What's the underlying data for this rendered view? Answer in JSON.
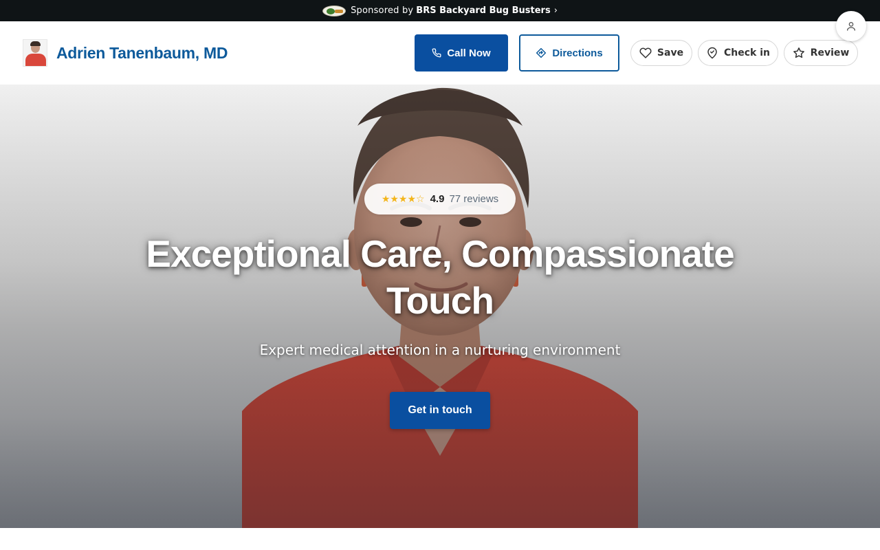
{
  "sponsor": {
    "prefix": "Sponsored by",
    "name": "BRS Backyard Bug Busters",
    "chevron": "›",
    "logo_icon": "sponsor-logo"
  },
  "header": {
    "doctor_name": "Adrien Tanenbaum, MD",
    "avatar_icon": "doctor-avatar",
    "actions": {
      "call_label": "Call Now",
      "directions_label": "Directions",
      "save_label": "Save",
      "checkin_label": "Check in",
      "review_label": "Review"
    },
    "icons": {
      "call": "phone-icon",
      "directions": "directions-icon",
      "save": "heart-icon",
      "checkin": "map-pin-icon",
      "review": "star-icon",
      "user": "user-icon"
    }
  },
  "hero": {
    "rating": {
      "stars_glyphs": "★★★★☆",
      "stars_value": 4.9,
      "value": "4.9",
      "reviews": "77 reviews"
    },
    "title": "Exceptional Care, Compassionate Touch",
    "subtitle": "Expert medical attention in a nurturing environment",
    "cta_label": "Get in touch"
  },
  "colors": {
    "brand_blue": "#0a4fa0",
    "name_blue": "#0d5a9b",
    "sponsor_bg": "#0f1416",
    "star": "#f3b51b",
    "shirt_red": "#c2443a"
  }
}
